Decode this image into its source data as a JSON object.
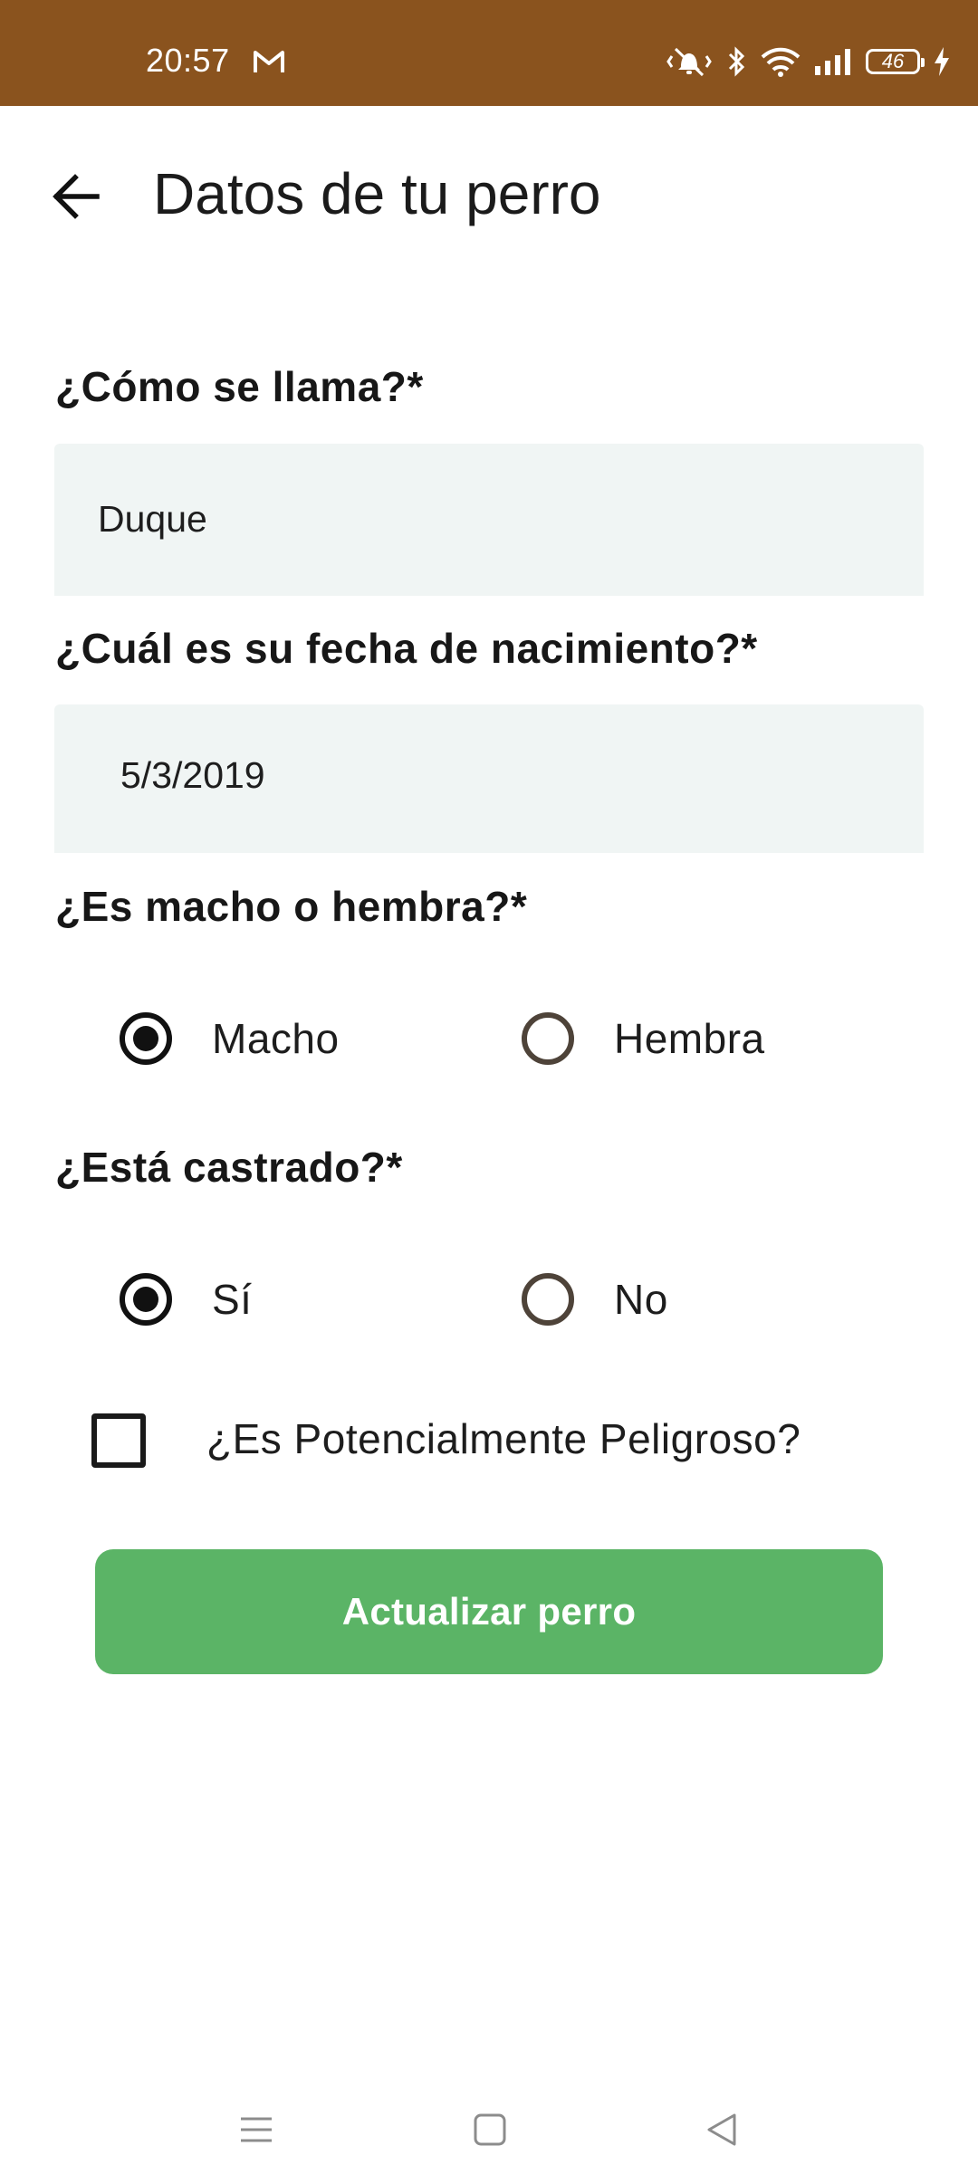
{
  "status_bar": {
    "time": "20:57",
    "battery": "46",
    "icons": [
      "gmail-icon",
      "vibrate-mute-icon",
      "bluetooth-icon",
      "wifi-icon",
      "signal-icon",
      "battery-icon",
      "charging-icon"
    ],
    "background": "#8a531e"
  },
  "app_bar": {
    "title": "Datos de tu perro",
    "back_icon": "arrow-back-icon"
  },
  "form": {
    "name_label": "¿Cómo se llama?*",
    "name_value": "Duque",
    "birth_label": "¿Cuál es su fecha de nacimiento?*",
    "birth_value": "5/3/2019",
    "sex_label": "¿Es macho o hembra?*",
    "sex_options": [
      {
        "label": "Macho",
        "selected": true
      },
      {
        "label": "Hembra",
        "selected": false
      }
    ],
    "neutered_label": "¿Está castrado?*",
    "neutered_options": [
      {
        "label": "Sí",
        "selected": true
      },
      {
        "label": "No",
        "selected": false
      }
    ],
    "dangerous_label": "¿Es Potencialmente Peligroso?",
    "dangerous_checked": false,
    "submit_label": "Actualizar perro",
    "field_background": "#f0f5f4",
    "button_color": "#5bb466"
  },
  "nav_bar": {
    "icons": [
      "menu-icon",
      "home-square-icon",
      "back-triangle-icon"
    ]
  }
}
